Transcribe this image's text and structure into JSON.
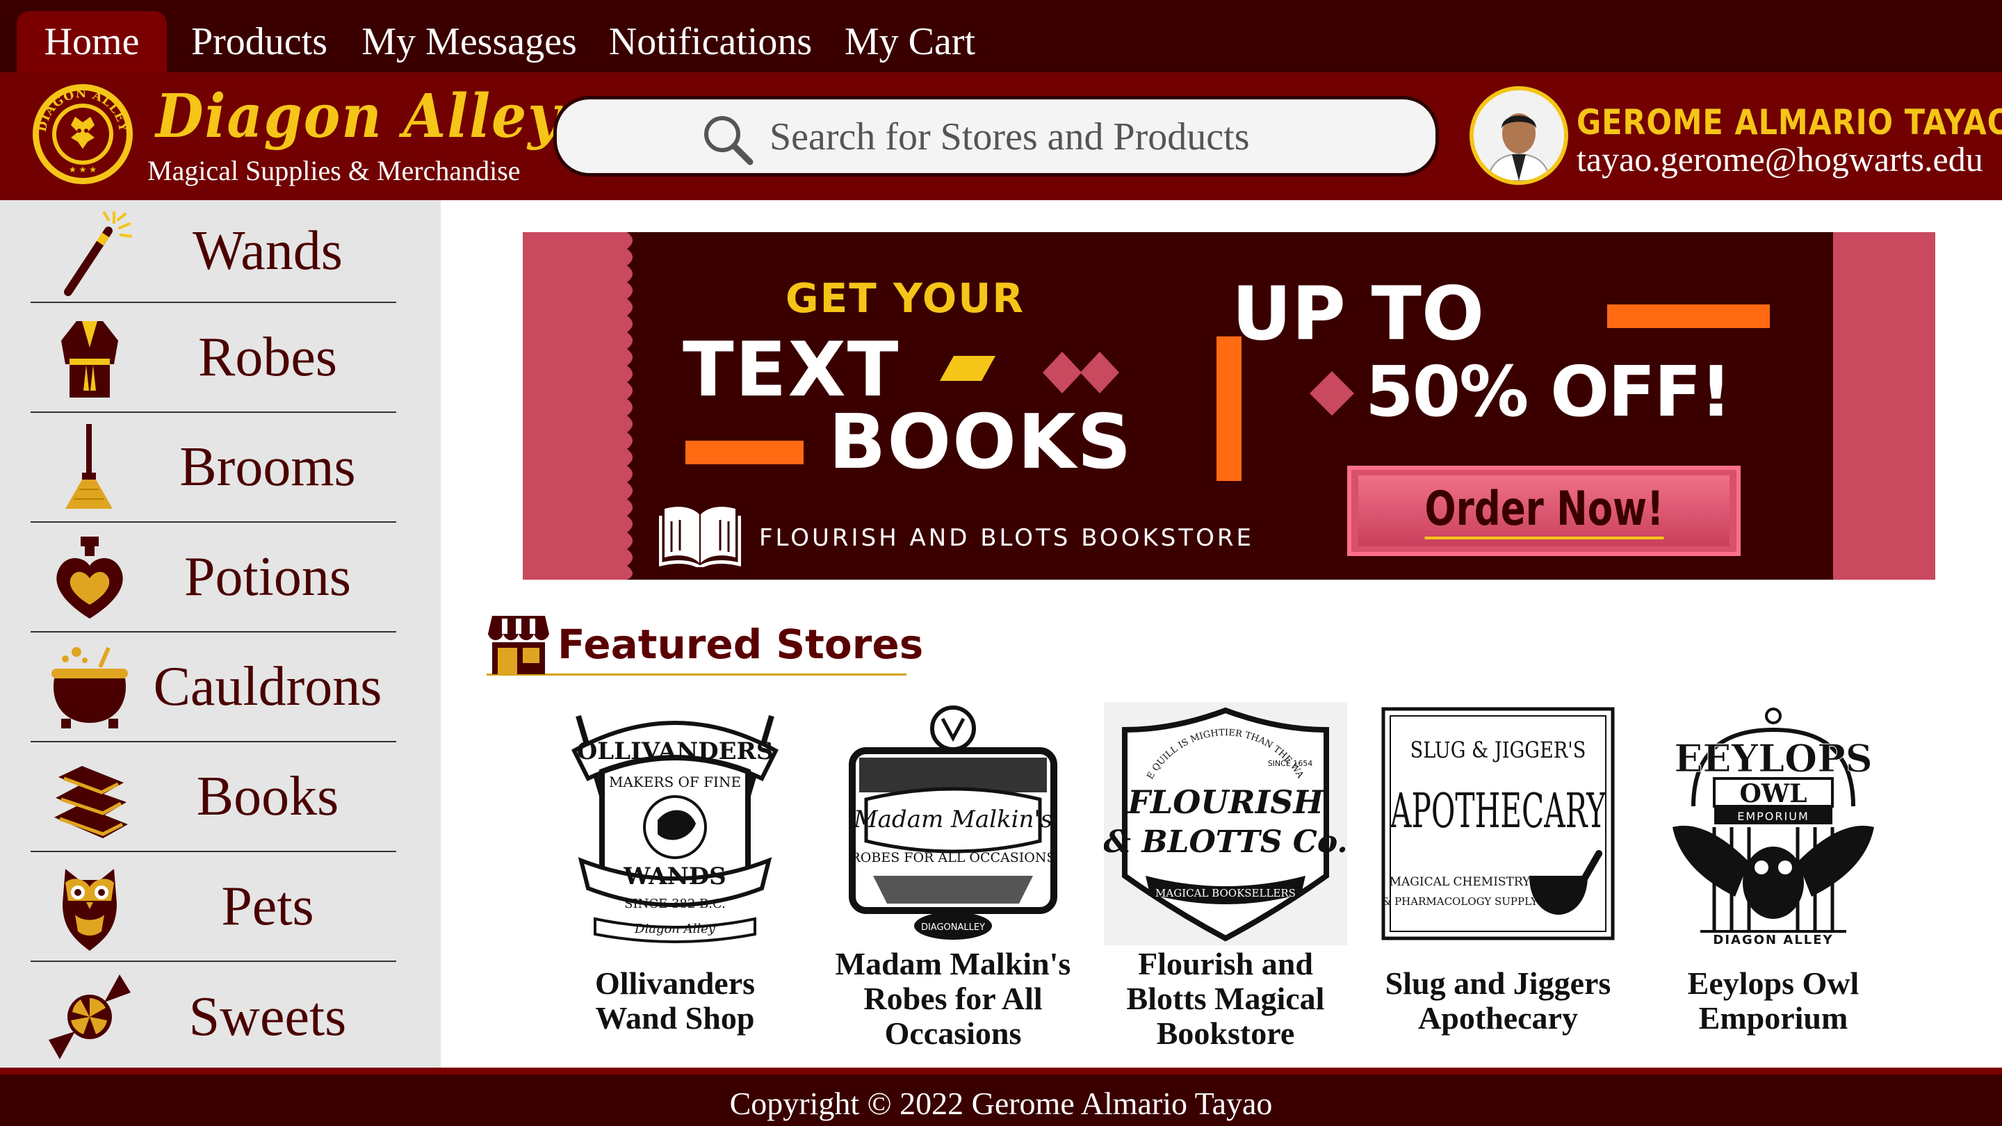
{
  "nav": {
    "tabs": [
      {
        "label": "Home",
        "active": true
      },
      {
        "label": "Products"
      },
      {
        "label": "My Messages"
      },
      {
        "label": "Notifications"
      },
      {
        "label": "My Cart"
      }
    ]
  },
  "brand": {
    "seal_text": "DIAGON ALLEY",
    "title": "Diagon Alley",
    "subtitle": "Magical Supplies & Merchandise"
  },
  "search": {
    "placeholder": "Search for Stores and Products",
    "icon": "search-icon"
  },
  "user": {
    "name": "GEROME ALMARIO TAYAO",
    "email": "tayao.gerome@hogwarts.edu"
  },
  "sidebar": {
    "items": [
      {
        "label": "Wands",
        "icon": "wand-icon"
      },
      {
        "label": "Robes",
        "icon": "robe-icon"
      },
      {
        "label": "Brooms",
        "icon": "broom-icon"
      },
      {
        "label": "Potions",
        "icon": "potion-icon"
      },
      {
        "label": "Cauldrons",
        "icon": "cauldron-icon"
      },
      {
        "label": "Books",
        "icon": "books-icon"
      },
      {
        "label": "Pets",
        "icon": "owl-icon"
      },
      {
        "label": "Sweets",
        "icon": "candy-icon"
      }
    ]
  },
  "banner": {
    "line1": "GET YOUR",
    "line2": "TEXT",
    "line3": "BOOKS",
    "store": "FLOURISH AND BLOTS BOOKSTORE",
    "discount_line1": "UP TO",
    "discount_line2": "50% OFF!",
    "cta": "Order Now!"
  },
  "featured": {
    "title": "Featured Stores",
    "stores": [
      {
        "name_line1": "Ollivanders",
        "name_line2": "Wand Shop",
        "logo": {
          "top": "OLLIVANDERS",
          "mid": "MAKERS OF FINE",
          "bottom": "WANDS",
          "since": "SINCE 382 B.C.",
          "scroll": "Diagon Alley"
        }
      },
      {
        "name_line1": "Madam Malkin's",
        "name_line2": "Robes for All",
        "name_line3": "Occasions",
        "logo": {
          "top": "Madam Malkin's",
          "mid": "ROBES FOR ALL OCCASIONS",
          "bottom": "DIAGONALLEY"
        }
      },
      {
        "name_line1": "Flourish and",
        "name_line2": "Blotts Magical",
        "name_line3": "Bookstore",
        "logo": {
          "arc": "THE QUILL IS MIGHTIER THAN THE WAND",
          "top": "FLOURISH",
          "bottom": "& BLOTTS Co.",
          "band": "MAGICAL BOOKSELLERS",
          "since": "SINCE 1654"
        }
      },
      {
        "name_line1": "Slug and Jiggers",
        "name_line2": "Apothecary",
        "logo": {
          "top": "SLUG & JIGGER'S",
          "mid": "APOTHECARY",
          "bottom1": "MAGICAL CHEMISTRY",
          "bottom2": "& PHARMACOLOGY SUPPLY"
        }
      },
      {
        "name_line1": "Eeylops Owl",
        "name_line2": "Emporium",
        "logo": {
          "top": "EEYLOPS",
          "mid": "OWL",
          "band": "EMPORIUM",
          "bottom": "DIAGON ALLEY"
        }
      }
    ]
  },
  "footer": {
    "copyright": "Copyright © 2022 Gerome Almario Tayao"
  },
  "colors": {
    "nav_bg": "#3a0000",
    "header_bg": "#720000",
    "gold": "#f5c518",
    "banner_pink": "#c9495f",
    "banner_orange": "#ff6a13",
    "sidebar_bg": "#e5e5e5"
  }
}
